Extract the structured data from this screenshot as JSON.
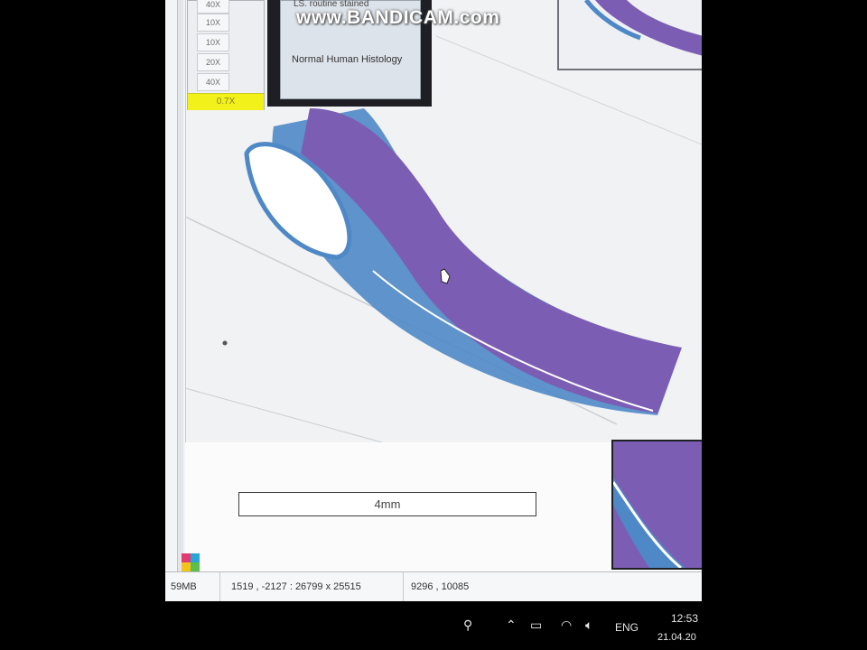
{
  "zoom_panel": {
    "levels": [
      "40X",
      "10X",
      "10X",
      "20X",
      "40X"
    ],
    "active": "0.7X"
  },
  "slide_label": {
    "top_text": "LS. routine stained",
    "name": "Normal Human Histology"
  },
  "watermark": "www.BANDICAM.com",
  "scale_bar": "4mm",
  "status_bar": {
    "memory": "59MB",
    "coords": "1519 , -2127 : 26799 x 25515",
    "size": "9296 , 10085"
  },
  "taskbar": {
    "language": "ENG",
    "time": "12:53",
    "date": "21.04.20"
  },
  "colors": {
    "tissue_purple": "#7c5db4",
    "connective_blue": "#4d86c4",
    "zoom_highlight": "#f2f21a"
  }
}
